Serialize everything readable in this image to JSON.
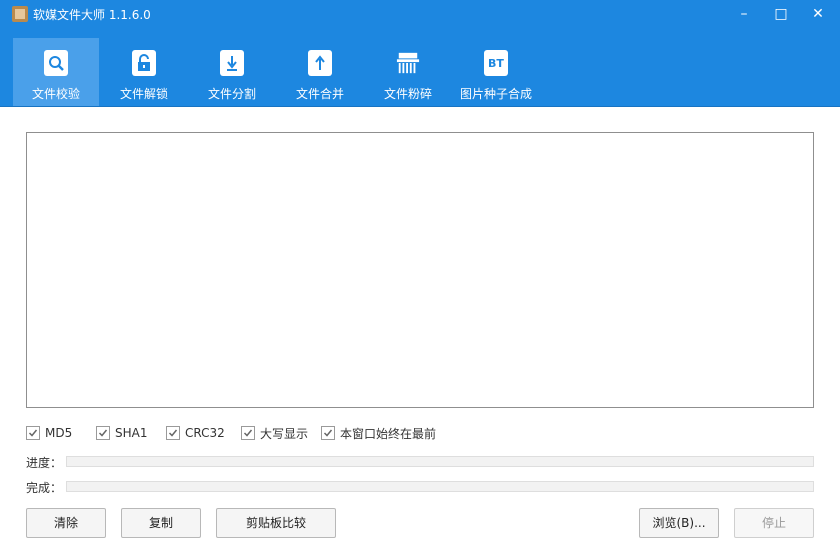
{
  "window": {
    "title": "软媒文件大师 1.1.6.0",
    "controls": {
      "minimize": "–",
      "maximize": "□",
      "close": "✕"
    }
  },
  "toolbar": {
    "tabs": [
      {
        "label": "文件校验",
        "icon": "magnifier-icon",
        "active": true
      },
      {
        "label": "文件解锁",
        "icon": "unlock-icon",
        "active": false
      },
      {
        "label": "文件分割",
        "icon": "file-split-icon",
        "active": false
      },
      {
        "label": "文件合并",
        "icon": "file-merge-icon",
        "active": false
      },
      {
        "label": "文件粉碎",
        "icon": "shredder-icon",
        "active": false
      },
      {
        "label": "图片种子合成",
        "icon": "bt-icon",
        "icon_text": "BT",
        "active": false
      }
    ]
  },
  "options": [
    {
      "label": "MD5",
      "checked": true
    },
    {
      "label": "SHA1",
      "checked": true
    },
    {
      "label": "CRC32",
      "checked": true
    },
    {
      "label": "大写显示",
      "checked": true
    },
    {
      "label": "本窗口始终在最前",
      "checked": true
    }
  ],
  "progress": {
    "label": "进度：",
    "value": 0
  },
  "complete": {
    "label": "完成：",
    "value": 0
  },
  "buttons": {
    "clear": "清除",
    "copy": "复制",
    "clipboard_compare": "剪贴板比较",
    "browse": "浏览(B)...",
    "stop": "停止"
  },
  "colors": {
    "accent": "#1d87e0",
    "active_tab": "#4aa0ea"
  }
}
